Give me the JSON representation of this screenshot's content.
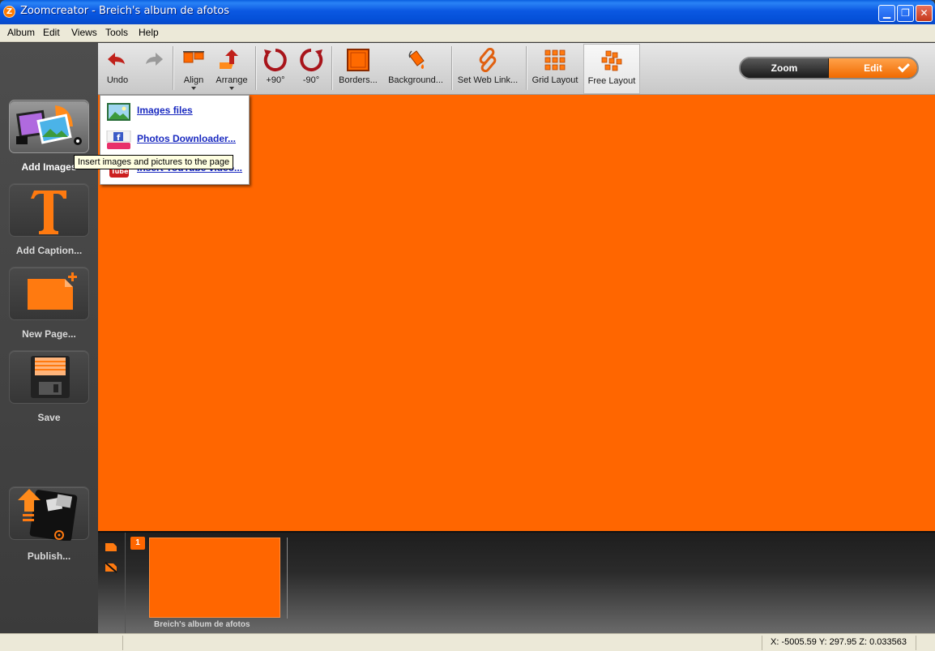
{
  "window": {
    "app_name": "Zoomcreator",
    "title": "Zoomcreator - Breich's album de afotos",
    "icon_letter": "Z",
    "minimize_glyph": "▁",
    "maximize_glyph": "❐",
    "close_glyph": "✕"
  },
  "menubar": {
    "items": [
      {
        "label": "Album"
      },
      {
        "label": "Edit"
      },
      {
        "label": "Views"
      },
      {
        "label": "Tools"
      },
      {
        "label": "Help"
      }
    ]
  },
  "sidebar": {
    "items": [
      {
        "label": "Add Images",
        "icon": "images-collage-icon",
        "active": true
      },
      {
        "label": "Add Caption...",
        "icon": "text-t-icon"
      },
      {
        "label": "New Page...",
        "icon": "new-page-icon"
      },
      {
        "label": "Save",
        "icon": "floppy-disk-icon"
      },
      {
        "label": "Publish...",
        "icon": "publish-upload-icon"
      }
    ]
  },
  "toolbar": {
    "undo": "Undo",
    "redo": "",
    "align": "Align",
    "arrange": "Arrange",
    "rotate_cw": "+90°",
    "rotate_ccw": "-90°",
    "borders": "Borders...",
    "background": "Background...",
    "web_link": "Set Web Link...",
    "grid_layout": "Grid Layout",
    "free_layout": "Free Layout"
  },
  "mode_toggle": {
    "zoom": "Zoom",
    "edit": "Edit",
    "selected": "edit"
  },
  "add_images_menu": {
    "items": [
      {
        "label": "Images files",
        "icon": "image-file-icon"
      },
      {
        "label": "Photos Downloader...",
        "icon": "facebook-icon"
      },
      {
        "label": "Insert YouTube video...",
        "icon": "youtube-icon"
      }
    ],
    "tooltip": "Insert images and pictures to the page"
  },
  "canvas": {
    "background_color": "#ff6600"
  },
  "filmstrip": {
    "pages": [
      {
        "number": "1",
        "title": "Breich's album de afotos"
      }
    ]
  },
  "statusbar": {
    "coords": "X: -5005.59 Y: 297.95 Z: 0.033563"
  },
  "colors": {
    "accent": "#ff6600",
    "titlebar": "#0a58e0",
    "link": "#1a2ac0"
  }
}
